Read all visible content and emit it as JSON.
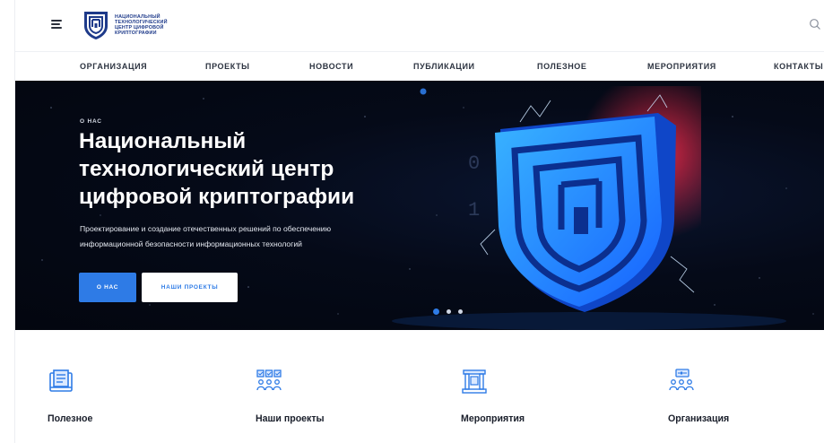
{
  "header": {
    "logo_lines": [
      "НАЦИОНАЛЬНЫЙ",
      "ТЕХНОЛОГИЧЕСКИЙ",
      "ЦЕНТР ЦИФРОВОЙ",
      "КРИПТОГРАФИИ"
    ],
    "menu_icon": "menu-icon",
    "search_icon": "search-icon"
  },
  "nav": {
    "items": [
      {
        "label": "ОРГАНИЗАЦИЯ"
      },
      {
        "label": "ПРОЕКТЫ"
      },
      {
        "label": "НОВОСТИ"
      },
      {
        "label": "ПУБЛИКАЦИИ"
      },
      {
        "label": "ПОЛЕЗНОЕ"
      },
      {
        "label": "МЕРОПРИЯТИЯ"
      },
      {
        "label": "КОНТАКТЫ"
      }
    ]
  },
  "hero": {
    "eyebrow": "О НАС",
    "title_lines": [
      "Национальный",
      "технологический центр",
      "цифровой криптографии"
    ],
    "desc_lines": [
      "Проектирование и создание отечественных решений по обеспечению",
      "информационной безопасности информационных технологий"
    ],
    "primary_button": "О НАС",
    "secondary_button": "НАШИ ПРОЕКТЫ",
    "slides_total": 3,
    "slide_active": 1
  },
  "features": [
    {
      "label": "Полезное",
      "icon": "book-icon"
    },
    {
      "label": "Наши проекты",
      "icon": "projects-icon"
    },
    {
      "label": "Мероприятия",
      "icon": "event-stage-icon"
    },
    {
      "label": "Организация",
      "icon": "organization-icon"
    }
  ],
  "colors": {
    "accent": "#2e7be6",
    "brand": "#1e3a8a",
    "hero_bg": "#050a18",
    "text": "#1a1f2b"
  }
}
